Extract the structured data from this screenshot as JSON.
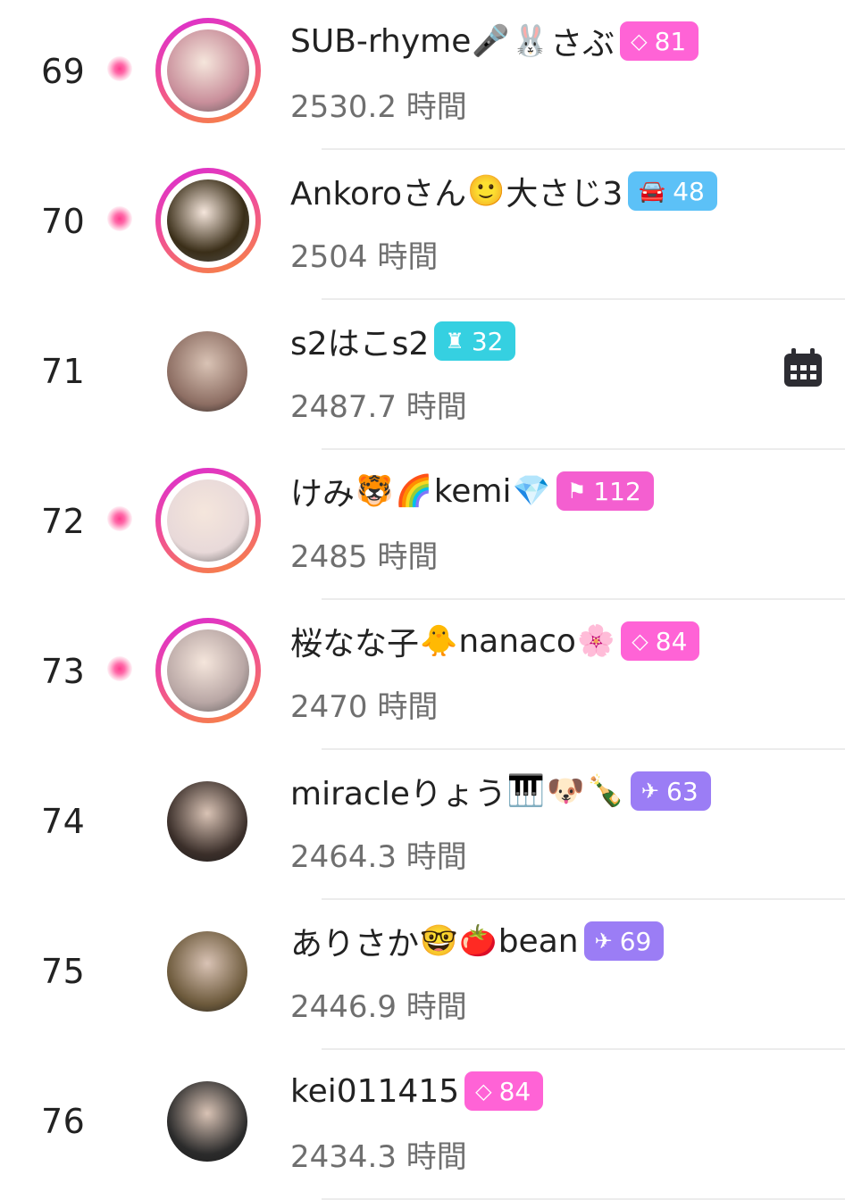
{
  "ranking_rows": [
    {
      "rank": "69",
      "name_parts": [
        {
          "t": "SUB-rhyme"
        },
        {
          "e": "🎤"
        },
        {
          "e": "🐰"
        },
        {
          "t": "さぶ"
        }
      ],
      "badge": {
        "icon": "gem-icon",
        "glyph": "◇",
        "value": "81",
        "color": "pink"
      },
      "hours": "2530.2 時間",
      "live": true,
      "avatar_style": "ring",
      "avatar_color": "#c98f9b"
    },
    {
      "rank": "70",
      "name_parts": [
        {
          "t": "Ankoroさん"
        },
        {
          "e": "🙂"
        },
        {
          "t": "大さじ3"
        }
      ],
      "badge": {
        "icon": "car-icon",
        "glyph": "🚘",
        "value": "48",
        "color": "blue"
      },
      "hours": "2504 時間",
      "live": true,
      "avatar_style": "ring",
      "avatar_color": "#3a2e18"
    },
    {
      "rank": "71",
      "name_parts": [
        {
          "t": "s2はこs2"
        }
      ],
      "badge": {
        "icon": "tower-icon",
        "glyph": "♜",
        "value": "32",
        "color": "cyan"
      },
      "hours": "2487.7 時間",
      "live": false,
      "avatar_style": "plain",
      "avatar_color": "#8d6e63",
      "calendar": true
    },
    {
      "rank": "72",
      "name_parts": [
        {
          "t": "けみ"
        },
        {
          "e": "🐯"
        },
        {
          "e": "🌈"
        },
        {
          "t": "kemi"
        },
        {
          "e": "💎"
        }
      ],
      "badge": {
        "icon": "flag-icon",
        "glyph": "⚑",
        "value": "112",
        "color": "magenta"
      },
      "hours": "2485 時間",
      "live": true,
      "avatar_style": "ring",
      "avatar_color": "#e8d9d9"
    },
    {
      "rank": "73",
      "name_parts": [
        {
          "t": "桜なな子"
        },
        {
          "e": "🐥"
        },
        {
          "t": "nanaco"
        },
        {
          "e": "🌸"
        }
      ],
      "badge": {
        "icon": "gem-icon",
        "glyph": "◇",
        "value": "84",
        "color": "pink"
      },
      "hours": "2470 時間",
      "live": true,
      "avatar_style": "ring",
      "avatar_color": "#b9a7a5"
    },
    {
      "rank": "74",
      "name_parts": [
        {
          "t": "miracleりょう"
        },
        {
          "e": "🎹"
        },
        {
          "e": "🐶"
        },
        {
          "e": "🍾"
        }
      ],
      "badge": {
        "icon": "plane-icon",
        "glyph": "✈",
        "value": "63",
        "color": "purple"
      },
      "hours": "2464.3 時間",
      "live": false,
      "avatar_style": "plain",
      "avatar_color": "#3b2f2a"
    },
    {
      "rank": "75",
      "name_parts": [
        {
          "t": "ありさか"
        },
        {
          "e": "🤓"
        },
        {
          "e": "🍅"
        },
        {
          "t": "bean"
        }
      ],
      "badge": {
        "icon": "plane-icon",
        "glyph": "✈",
        "value": "69",
        "color": "purple"
      },
      "hours": "2446.9 時間",
      "live": false,
      "avatar_style": "plain",
      "avatar_color": "#6d5a3c"
    },
    {
      "rank": "76",
      "name_parts": [
        {
          "t": "kei011415"
        }
      ],
      "badge": {
        "icon": "gem-icon",
        "glyph": "◇",
        "value": "84",
        "color": "pink"
      },
      "hours": "2434.3 時間",
      "live": false,
      "avatar_style": "plain",
      "avatar_color": "#2b2b2b"
    }
  ],
  "icons": {
    "live": "live-dot-icon",
    "calendar": "calendar-icon"
  }
}
